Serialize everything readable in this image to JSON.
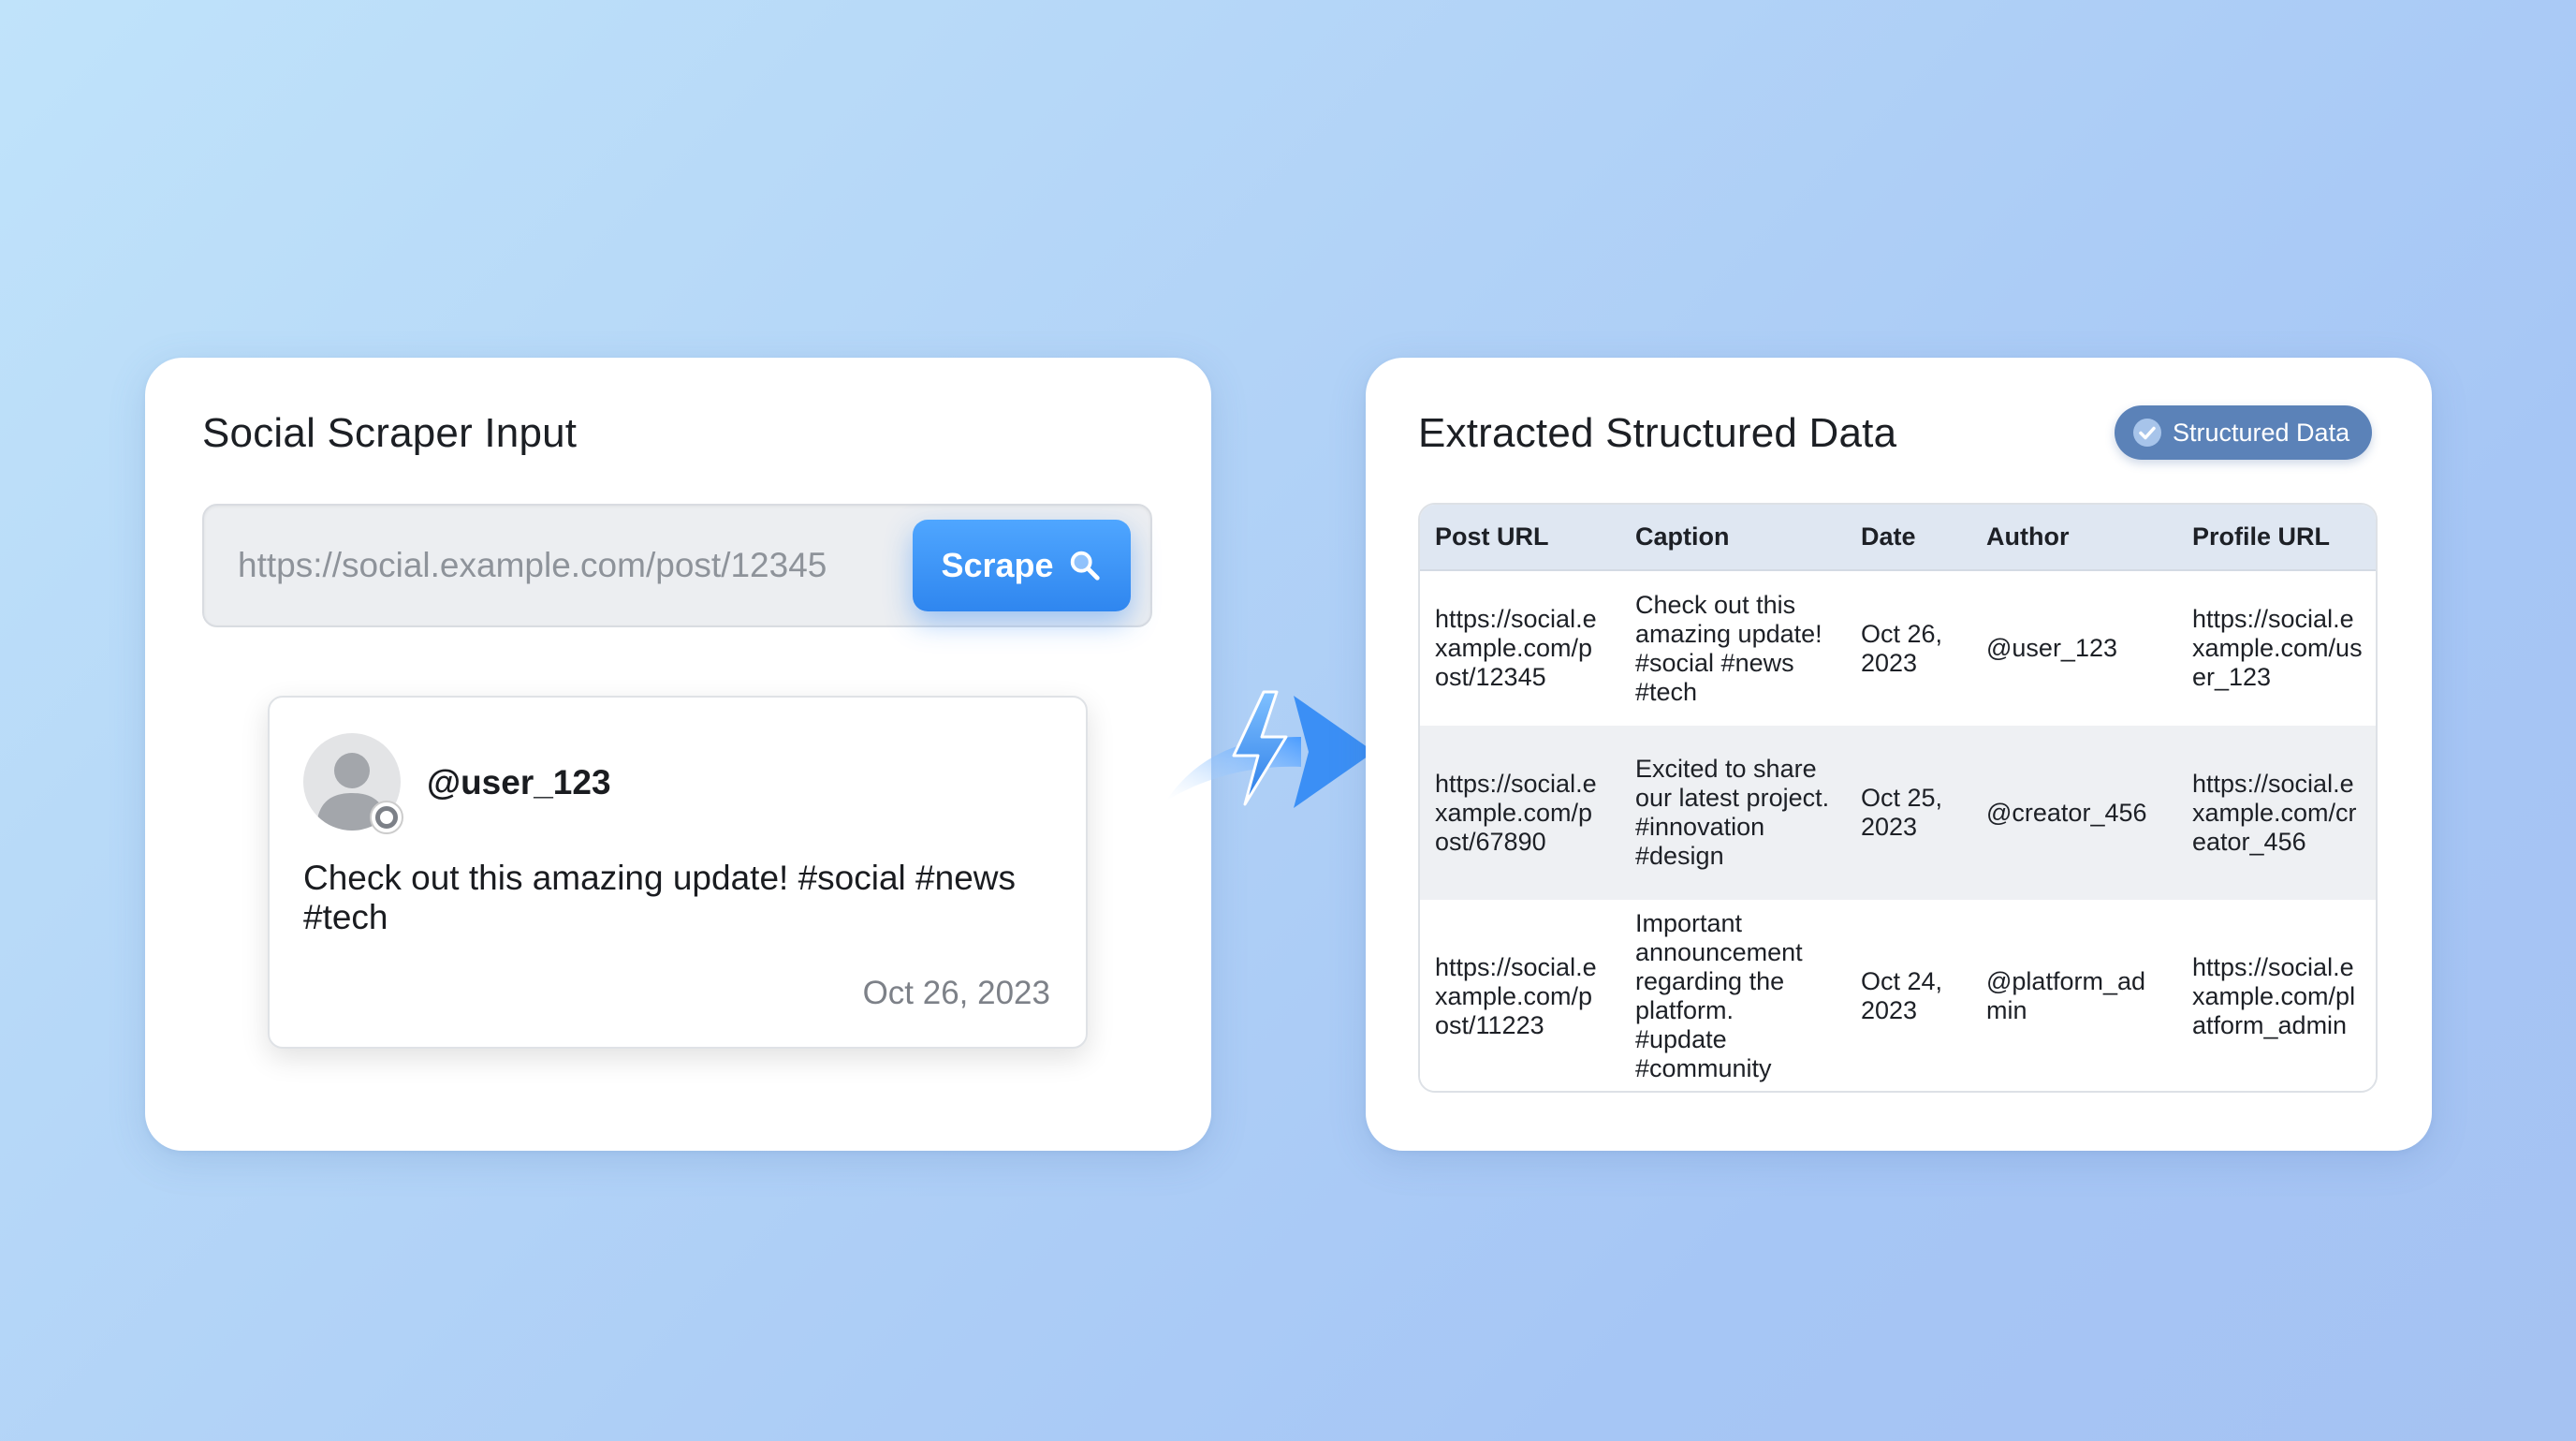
{
  "input_panel": {
    "title": "Social Scraper Input",
    "url_input": {
      "value": "",
      "placeholder": "https://social.example.com/post/12345"
    },
    "scrape_button_label": "Scrape",
    "post_preview": {
      "username": "@user_123",
      "caption": "Check out this amazing update! #social #news #tech",
      "date": "Oct 26, 2023"
    }
  },
  "output_panel": {
    "title": "Extracted Structured Data",
    "badge_label": "Structured Data",
    "table": {
      "headers": [
        "Post URL",
        "Caption",
        "Date",
        "Author",
        "Profile URL"
      ],
      "rows": [
        [
          "https://social.example.com/post/12345",
          "Check out this amazing update! #social #news #tech",
          "Oct 26, 2023",
          "@user_123",
          "https://social.example.com/user_123"
        ],
        [
          "https://social.example.com/post/67890",
          "Excited to share our latest project. #innovation #design",
          "Oct 25, 2023",
          "@creator_456",
          "https://social.example.com/creator_456"
        ],
        [
          "https://social.example.com/post/11223",
          "Important announcement regarding the platform. #update #community",
          "Oct 24, 2023",
          "@platform_admin",
          "https://social.example.com/platform_admin"
        ]
      ]
    }
  },
  "icons": {
    "search": "search-icon",
    "avatar": "user-avatar-icon",
    "flow": "lightning-arrow-icon",
    "check": "check-circle-icon"
  },
  "colors": {
    "accent": "#3a93f8",
    "badge": "#5b82b8",
    "table_header": "#dfe7f2"
  }
}
